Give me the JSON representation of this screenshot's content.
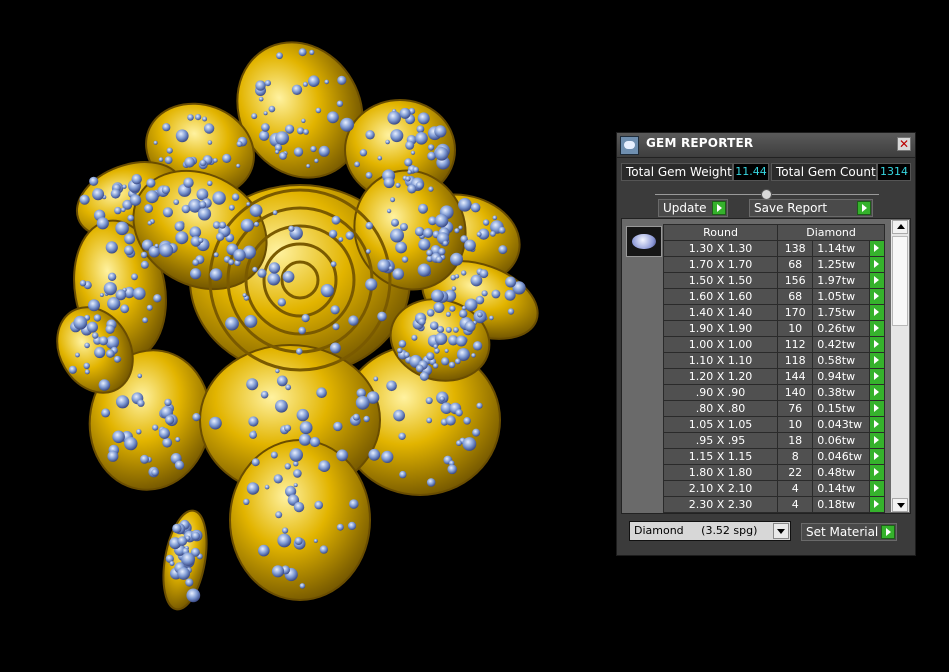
{
  "viewport": {
    "subject": "gold-rose-brooch-render",
    "colors": {
      "metal": "#e2b400",
      "gem": "#7f9bd4",
      "background": "#000000"
    }
  },
  "panel": {
    "title": "GEM REPORTER",
    "total_gem_weight_label": "Total Gem Weight",
    "total_gem_weight_value": "11.44",
    "total_gem_count_label": "Total Gem Count",
    "total_gem_count_value": "1314",
    "update_label": "Update",
    "save_report_label": "Save Report",
    "table": {
      "headers": [
        "Round",
        "Diamond"
      ],
      "rows": [
        {
          "size": "1.30 X 1.30",
          "count": "138",
          "weight": "1.14tw"
        },
        {
          "size": "1.70 X 1.70",
          "count": "68",
          "weight": "1.25tw"
        },
        {
          "size": "1.50 X 1.50",
          "count": "156",
          "weight": "1.97tw"
        },
        {
          "size": "1.60 X 1.60",
          "count": "68",
          "weight": "1.05tw"
        },
        {
          "size": "1.40 X 1.40",
          "count": "170",
          "weight": "1.75tw"
        },
        {
          "size": "1.90 X 1.90",
          "count": "10",
          "weight": "0.26tw"
        },
        {
          "size": "1.00 X 1.00",
          "count": "112",
          "weight": "0.42tw"
        },
        {
          "size": "1.10 X 1.10",
          "count": "118",
          "weight": "0.58tw"
        },
        {
          "size": "1.20 X 1.20",
          "count": "144",
          "weight": "0.94tw"
        },
        {
          "size": ".90 X .90",
          "count": "140",
          "weight": "0.38tw"
        },
        {
          "size": ".80 X .80",
          "count": "76",
          "weight": "0.15tw"
        },
        {
          "size": "1.05 X 1.05",
          "count": "10",
          "weight": "0.043tw"
        },
        {
          "size": ".95 X .95",
          "count": "18",
          "weight": "0.06tw"
        },
        {
          "size": "1.15 X 1.15",
          "count": "8",
          "weight": "0.046tw"
        },
        {
          "size": "1.80 X 1.80",
          "count": "22",
          "weight": "0.48tw"
        },
        {
          "size": "2.10 X 2.10",
          "count": "4",
          "weight": "0.14tw"
        },
        {
          "size": "2.30 X 2.30",
          "count": "4",
          "weight": "0.18tw"
        }
      ]
    },
    "material_selected": "Diamond     (3.52 spg)",
    "set_material_label": "Set Material",
    "icons": [
      "app-icon",
      "close-icon",
      "gem-thumbnail",
      "play-icon",
      "dropdown-arrow-icon"
    ]
  }
}
